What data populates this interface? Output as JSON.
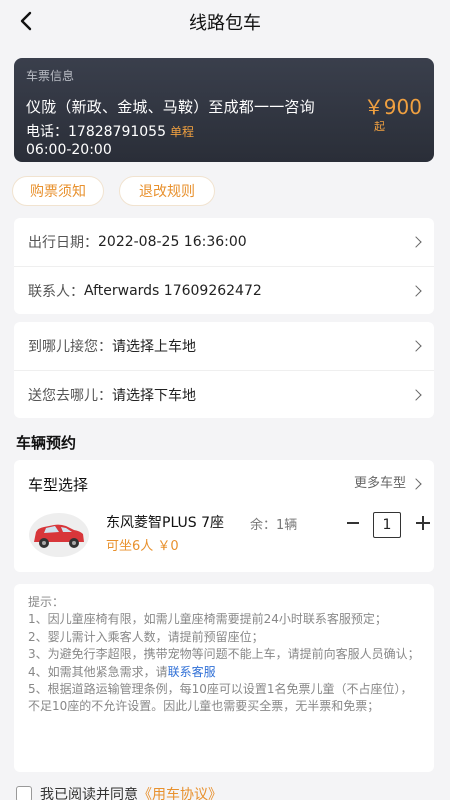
{
  "header": {
    "title": "线路包车"
  },
  "ticket": {
    "label": "车票信息",
    "route": "仪陇（新政、金城、马鞍）至成都一一咨询",
    "phone": "电话：17828791055",
    "tag": "单程",
    "hours": "06:00-20:00",
    "price": "￥900",
    "price_suffix": "起"
  },
  "pills": {
    "notice": "购票须知",
    "refund": "退改规则"
  },
  "info": {
    "date_label": "出行日期：",
    "date_value": "2022-08-25 16:36:00",
    "contact_label": "联系人：",
    "contact_value": "Afterwards 17609262472"
  },
  "locations": {
    "pickup_label": "到哪儿接您：",
    "pickup_value": "请选择上车地",
    "dropoff_label": "送您去哪儿：",
    "dropoff_value": "请选择下车地"
  },
  "vehicle": {
    "section_title": "车辆预约",
    "type_label": "车型选择",
    "more_label": "更多车型",
    "car_name": "东风菱智PLUS 7座",
    "remaining": "余：1辆",
    "capacity_price": "可坐6人 ￥0",
    "quantity": "1"
  },
  "tips": {
    "title": "提示：",
    "l1": "1、因儿童座椅有限，如需儿童座椅需要提前24小时联系客服预定；",
    "l2": "2、婴儿需计入乘客人数，请提前预留座位；",
    "l3": "3、为避免行李超限，携带宠物等问题不能上车，请提前向客服人员确认；",
    "l4a": "4、如需其他紧急需求，请",
    "l4_link": "联系客服",
    "l5": "5、根据道路运输管理条例，每10座可以设置1名免票儿童（不占座位），不足10座的不允许设置。因此儿童也需要买全票，无半票和免票；"
  },
  "agreement": {
    "text": "我已阅读并同意",
    "link": "《用车协议》"
  },
  "colors": {
    "accent": "#e8912e",
    "ticket_bg": "#2f333d",
    "link": "#2f6fd6"
  }
}
